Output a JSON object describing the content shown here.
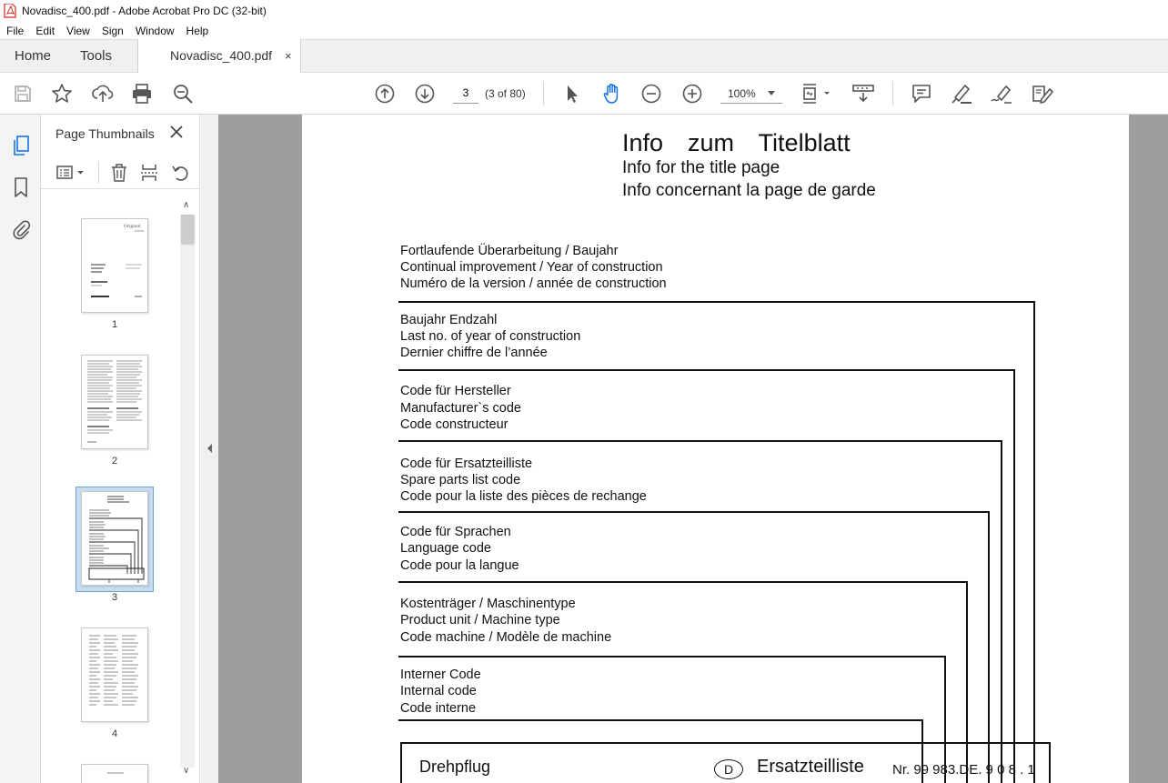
{
  "window": {
    "title": "Novadisc_400.pdf - Adobe Acrobat Pro DC (32-bit)",
    "app_icon": "acrobat-pdf-icon",
    "accent_color": "#d4251e"
  },
  "menu": {
    "items": [
      {
        "label": "File"
      },
      {
        "label": "Edit"
      },
      {
        "label": "View"
      },
      {
        "label": "Sign"
      },
      {
        "label": "Window"
      },
      {
        "label": "Help"
      }
    ]
  },
  "tabs": {
    "home": "Home",
    "tools": "Tools",
    "document": "Novadisc_400.pdf",
    "close_glyph": "×"
  },
  "toolbar": {
    "page_number": "3",
    "page_of": "(3 of 80)",
    "zoom": "100%",
    "icons": [
      "save-icon",
      "bookmark-star-icon",
      "upload-share-icon",
      "print-icon",
      "search-zoom-icon",
      "page-up-icon",
      "page-down-icon",
      "select-cursor-icon",
      "hand-tool-icon",
      "zoom-out-icon",
      "zoom-in-icon",
      "page-fit-icon",
      "scroll-mode-icon",
      "comment-icon",
      "highlight-icon",
      "draw-sign-icon",
      "edit-pdf-icon"
    ],
    "active_tool_color": "#1473e6"
  },
  "sidebar": {
    "panel_title": "Page Thumbnails",
    "rail_icons": [
      "page-thumbnails-icon",
      "bookmarks-icon",
      "attachments-icon"
    ],
    "panel_tool_icons": [
      "thumbnail-options-icon",
      "delete-page-icon",
      "split-page-icon",
      "undo-rotate-icon"
    ],
    "thumbnails": [
      {
        "label": "1",
        "selected": false
      },
      {
        "label": "2",
        "selected": false
      },
      {
        "label": "3",
        "selected": true
      },
      {
        "label": "4",
        "selected": false
      }
    ],
    "thumb1_brand": "Original"
  },
  "document": {
    "title_de": "Info  zum  Titelblatt",
    "title_en": "Info for the title page",
    "title_fr": "Info concernant la page de garde",
    "sections": [
      {
        "lines": [
          "Fortlaufende Überarbeitung / Baujahr",
          "Continual improvement / Year of construction",
          "Numéro de la version / année de construction"
        ]
      },
      {
        "lines": [
          "Baujahr Endzahl",
          "Last no. of year of construction",
          "Dernier chiffre de l’année"
        ]
      },
      {
        "lines": [
          "Code für Hersteller",
          "Manufacturer`s  code",
          "Code constructeur"
        ]
      },
      {
        "lines": [
          "Code für Ersatzteilliste",
          "Spare parts list code",
          "Code pour la liste des pièces de rechange"
        ]
      },
      {
        "lines": [
          "Code für Sprachen",
          "Language code",
          "Code pour la langue"
        ]
      },
      {
        "lines": [
          "Kostenträger / Maschinentype",
          "Product unit / Machine type",
          "Code machine / Modèle de machine"
        ]
      },
      {
        "lines": [
          "Interner Code",
          "Internal code",
          "Code interne"
        ]
      }
    ],
    "box": {
      "left_label": "Drehpflug",
      "circle_label": "D",
      "right_label": "Ersatzteilliste",
      "number": "Nr. 99 983.DE. 9 0 8 . 1"
    }
  }
}
